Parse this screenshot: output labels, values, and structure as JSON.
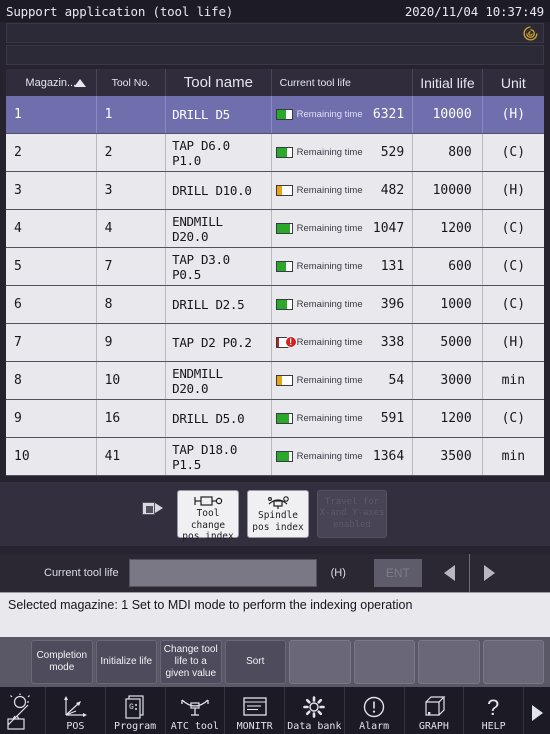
{
  "titlebar": {
    "title": "Support application (tool life)",
    "datetime": "2020/11/04 10:37:49",
    "logo_icon": "brand-swirl-icon"
  },
  "table": {
    "headers": {
      "magazine": "Magazin...",
      "tool_no": "Tool No.",
      "tool_name": "Tool name",
      "current_tool_life": "Current tool life",
      "initial_life": "Initial life",
      "unit": "Unit"
    },
    "sort": {
      "column": "magazine",
      "direction": "ascending",
      "icon": "sort-asc-arrow-icon"
    },
    "life_label": "Remaining time",
    "rows": [
      {
        "magazine": "1",
        "tool_no": "1",
        "tool_name": "DRILL D5",
        "life_value": "6321",
        "initial_life": "10000",
        "unit": "(H)",
        "gauge_pct": 63,
        "gauge_color": "#2aa82a",
        "warn": false,
        "selected": true
      },
      {
        "magazine": "2",
        "tool_no": "2",
        "tool_name": "TAP D6.0 P1.0",
        "life_value": "529",
        "initial_life": "800",
        "unit": "(C)",
        "gauge_pct": 66,
        "gauge_color": "#2aa82a",
        "warn": false,
        "selected": false
      },
      {
        "magazine": "3",
        "tool_no": "3",
        "tool_name": "DRILL D10.0",
        "life_value": "482",
        "initial_life": "10000",
        "unit": "(H)",
        "gauge_pct": 34,
        "gauge_color": "#e8a317",
        "warn": false,
        "selected": false
      },
      {
        "magazine": "4",
        "tool_no": "4",
        "tool_name": "ENDMILL D20.0",
        "life_value": "1047",
        "initial_life": "1200",
        "unit": "(C)",
        "gauge_pct": 87,
        "gauge_color": "#2aa82a",
        "warn": false,
        "selected": false
      },
      {
        "magazine": "5",
        "tool_no": "7",
        "tool_name": "TAP D3.0 P0.5",
        "life_value": "131",
        "initial_life": "600",
        "unit": "(C)",
        "gauge_pct": 60,
        "gauge_color": "#2aa82a",
        "warn": false,
        "selected": false
      },
      {
        "magazine": "6",
        "tool_no": "8",
        "tool_name": "DRILL D2.5",
        "life_value": "396",
        "initial_life": "1000",
        "unit": "(C)",
        "gauge_pct": 70,
        "gauge_color": "#2aa82a",
        "warn": false,
        "selected": false
      },
      {
        "magazine": "7",
        "tool_no": "9",
        "tool_name": "TAP D2 P0.2",
        "life_value": "338",
        "initial_life": "5000",
        "unit": "(H)",
        "gauge_pct": 18,
        "gauge_color": "#c22020",
        "warn": true,
        "selected": false
      },
      {
        "magazine": "8",
        "tool_no": "10",
        "tool_name": "ENDMILL D20.0",
        "life_value": "54",
        "initial_life": "3000",
        "unit": "min",
        "gauge_pct": 34,
        "gauge_color": "#e8a317",
        "warn": false,
        "selected": false
      },
      {
        "magazine": "9",
        "tool_no": "16",
        "tool_name": "DRILL D5.0",
        "life_value": "591",
        "initial_life": "1200",
        "unit": "(C)",
        "gauge_pct": 80,
        "gauge_color": "#2aa82a",
        "warn": false,
        "selected": false
      },
      {
        "magazine": "10",
        "tool_no": "41",
        "tool_name": "TAP D18.0 P1.5",
        "life_value": "1364",
        "initial_life": "3500",
        "unit": "min",
        "gauge_pct": 80,
        "gauge_color": "#2aa82a",
        "warn": false,
        "selected": false
      }
    ]
  },
  "mid_panel": {
    "tab_marker_icon": "tab-expand-icon",
    "buttons": [
      {
        "label_line1": "Tool change",
        "label_line2": "pos index",
        "icon": "tool-change-position-icon",
        "disabled": false
      },
      {
        "label_line1": "Spindle",
        "label_line2": "pos index",
        "icon": "spindle-position-icon",
        "disabled": false
      },
      {
        "label_line1": "Travel for X-and Y-axes enabled",
        "label_line2": "",
        "icon": "",
        "disabled": true
      }
    ]
  },
  "input_bar": {
    "label": "Current tool life",
    "value": "",
    "placeholder": "",
    "unit": "(H)",
    "enter_label": "ENT",
    "prev_icon": "arrow-left-icon",
    "next_icon": "arrow-right-icon"
  },
  "message_bar": {
    "text": "Selected magazine: 1  Set to MDI mode to perform the indexing operation"
  },
  "soft_keys": [
    {
      "label": "Completion mode",
      "empty": false
    },
    {
      "label": "Initialize life",
      "empty": false
    },
    {
      "label": "Change tool life to a given value",
      "empty": false
    },
    {
      "label": "Sort",
      "empty": false
    },
    {
      "label": "",
      "empty": true
    },
    {
      "label": "",
      "empty": true
    },
    {
      "label": "",
      "empty": true
    },
    {
      "label": "",
      "empty": true
    }
  ],
  "bottom_nav": {
    "home_icon": "machine-lamp-icon",
    "items": [
      {
        "label": "POS",
        "icon": "axes-position-icon"
      },
      {
        "label": "Program",
        "icon": "program-document-icon"
      },
      {
        "label": "ATC tool",
        "icon": "atc-tool-icon"
      },
      {
        "label": "MONITR",
        "icon": "monitor-window-icon"
      },
      {
        "label": "Data bank",
        "icon": "gear-icon"
      },
      {
        "label": "Alarm",
        "icon": "alarm-exclamation-icon"
      },
      {
        "label": "GRAPH",
        "icon": "cube-graph-icon"
      },
      {
        "label": "HELP",
        "icon": "question-mark-icon"
      }
    ],
    "more_icon": "arrow-right-icon"
  },
  "colors": {
    "selection": "#6f6fae",
    "ok_green": "#2aa82a",
    "warn_orange": "#e8a317",
    "alarm_red": "#c22020",
    "brand_gold": "#c9a227"
  }
}
